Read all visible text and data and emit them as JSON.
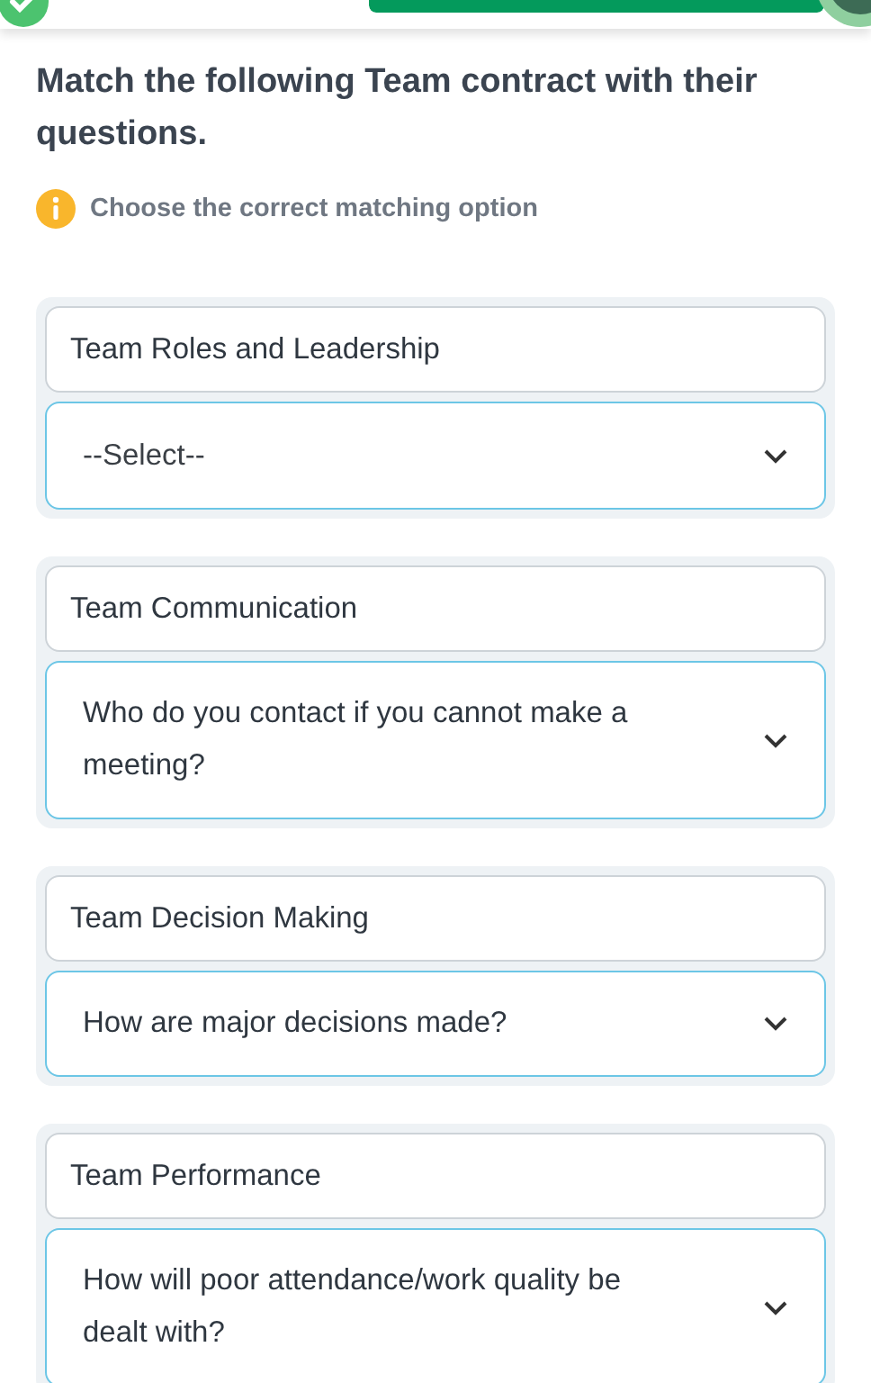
{
  "header": {
    "completed": true
  },
  "question": {
    "title": "Match the following Team contract with their questions.",
    "hint": "Choose the correct matching option"
  },
  "pairs": [
    {
      "label": "Team Roles and Leadership",
      "answer": "--Select--",
      "answered": false
    },
    {
      "label": "Team Communication",
      "answer": "Who do you contact if you cannot make a meeting?",
      "answered": true
    },
    {
      "label": "Team Decision Making",
      "answer": "How are major decisions made?",
      "answered": true
    },
    {
      "label": "Team Performance",
      "answer": "How will poor attendance/work quality be dealt with?",
      "answered": true
    }
  ]
}
